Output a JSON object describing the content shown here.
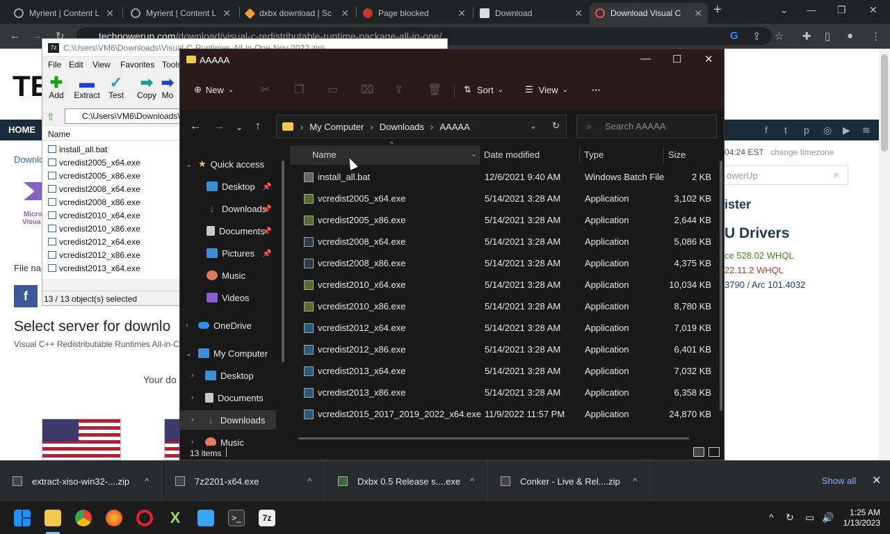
{
  "browser": {
    "tabs": [
      {
        "title": "Myrient | Content L",
        "active": false
      },
      {
        "title": "Myrient | Content L",
        "active": false
      },
      {
        "title": "dxbx download | Sc",
        "active": false
      },
      {
        "title": "Page blocked",
        "active": false
      },
      {
        "title": "Download",
        "active": false
      },
      {
        "title": "Download Visual C",
        "active": true
      }
    ],
    "url_host": "techpowerup.com",
    "url_path": "/download/visual-c-redistributable-runtime-package-all-in-one/"
  },
  "webpage": {
    "logo": "TE",
    "nav_home": "HOME",
    "side_left_text": "Downlo",
    "ms_logo_1": "Micro",
    "ms_logo_2": "Visua",
    "file_name_label": "File na",
    "time_text": "04:24 EST",
    "change_timezone": "change timezone",
    "search_placeholder": "owerUp",
    "register": "ister",
    "drivers_heading": "U Drivers",
    "driver1": "ce 528.02 WHQL",
    "driver2": "22.11.2 WHQL",
    "driver3": "3790 / Arc 101.4032",
    "select_server": "Select server for downlo",
    "subtitle": "Visual C++ Redistributable Runtimes All-in-C",
    "your_download": "Your do"
  },
  "sevenzip": {
    "title": "C:\\Users\\VM6\\Downloads\\Visual-C-Runtimes-All-in-One-Nov-2022.zip\\",
    "menu": [
      "File",
      "Edit",
      "View",
      "Favorites",
      "Tools"
    ],
    "toolbar": [
      "Add",
      "Extract",
      "Test",
      "Copy",
      "Mo"
    ],
    "path": "C:\\Users\\VM6\\Downloads\\",
    "column_name": "Name",
    "files": [
      "install_all.bat",
      "vcredist2005_x64.exe",
      "vcredist2005_x86.exe",
      "vcredist2008_x64.exe",
      "vcredist2008_x86.exe",
      "vcredist2010_x64.exe",
      "vcredist2010_x86.exe",
      "vcredist2012_x64.exe",
      "vcredist2012_x86.exe",
      "vcredist2013_x64.exe"
    ],
    "status": "13 / 13 object(s) selected"
  },
  "explorer": {
    "title": "AAAAA",
    "new_label": "New",
    "sort_label": "Sort",
    "view_label": "View",
    "more_label": "···",
    "breadcrumb": [
      "My Computer",
      "Downloads",
      "AAAAA"
    ],
    "search_placeholder": "Search AAAAA",
    "columns": {
      "name": "Name",
      "date": "Date modified",
      "type": "Type",
      "size": "Size"
    },
    "nav": [
      {
        "label": "Quick access",
        "level": 0
      },
      {
        "label": "Desktop",
        "level": 1
      },
      {
        "label": "Downloads",
        "level": 1
      },
      {
        "label": "Documents",
        "level": 1
      },
      {
        "label": "Pictures",
        "level": 1
      },
      {
        "label": "Music",
        "level": 1
      },
      {
        "label": "Videos",
        "level": 1
      },
      {
        "label": "OneDrive",
        "level": 0
      },
      {
        "label": "My Computer",
        "level": 0
      },
      {
        "label": "Desktop",
        "level": 1
      },
      {
        "label": "Documents",
        "level": 1
      },
      {
        "label": "Downloads",
        "level": 1
      },
      {
        "label": "Music",
        "level": 1
      }
    ],
    "files": [
      {
        "name": "install_all.bat",
        "date": "12/6/2021 9:40 AM",
        "type": "Windows Batch File",
        "size": "2 KB"
      },
      {
        "name": "vcredist2005_x64.exe",
        "date": "5/14/2021 3:28 AM",
        "type": "Application",
        "size": "3,102 KB"
      },
      {
        "name": "vcredist2005_x86.exe",
        "date": "5/14/2021 3:28 AM",
        "type": "Application",
        "size": "2,644 KB"
      },
      {
        "name": "vcredist2008_x64.exe",
        "date": "5/14/2021 3:28 AM",
        "type": "Application",
        "size": "5,086 KB"
      },
      {
        "name": "vcredist2008_x86.exe",
        "date": "5/14/2021 3:28 AM",
        "type": "Application",
        "size": "4,375 KB"
      },
      {
        "name": "vcredist2010_x64.exe",
        "date": "5/14/2021 3:28 AM",
        "type": "Application",
        "size": "10,034 KB"
      },
      {
        "name": "vcredist2010_x86.exe",
        "date": "5/14/2021 3:28 AM",
        "type": "Application",
        "size": "8,780 KB"
      },
      {
        "name": "vcredist2012_x64.exe",
        "date": "5/14/2021 3:28 AM",
        "type": "Application",
        "size": "7,019 KB"
      },
      {
        "name": "vcredist2012_x86.exe",
        "date": "5/14/2021 3:28 AM",
        "type": "Application",
        "size": "6,401 KB"
      },
      {
        "name": "vcredist2013_x64.exe",
        "date": "5/14/2021 3:28 AM",
        "type": "Application",
        "size": "7,032 KB"
      },
      {
        "name": "vcredist2013_x86.exe",
        "date": "5/14/2021 3:28 AM",
        "type": "Application",
        "size": "6,358 KB"
      },
      {
        "name": "vcredist2015_2017_2019_2022_x64.exe",
        "date": "11/9/2022 11:57 PM",
        "type": "Application",
        "size": "24,870 KB"
      }
    ],
    "status": "13 items"
  },
  "downloads": {
    "items": [
      "extract-xiso-win32-....zip",
      "7z2201-x64.exe",
      "Dxbx 0.5 Release s....exe",
      "Conker - Live & Rel....zip"
    ],
    "show_all": "Show all"
  },
  "taskbar": {
    "time": "1:25 AM",
    "date": "1/13/2023"
  }
}
